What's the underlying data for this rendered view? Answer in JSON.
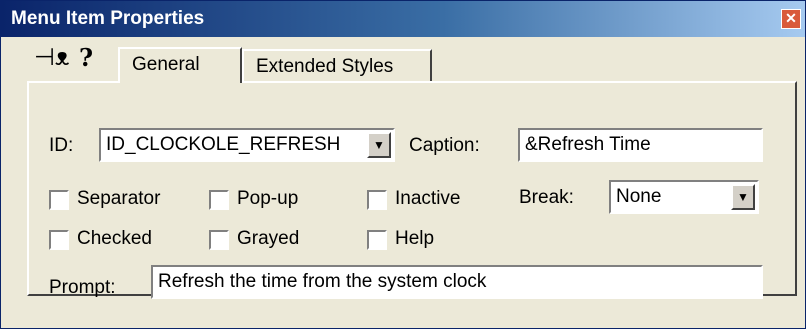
{
  "window": {
    "title": "Menu Item Properties",
    "close_glyph": "✕"
  },
  "toolbar": {
    "pin_icon": "push-pin-icon",
    "help_icon": "help-icon"
  },
  "tabs": [
    {
      "label": "General",
      "active": true
    },
    {
      "label": "Extended Styles",
      "active": false
    }
  ],
  "form": {
    "id_label": "ID:",
    "id_value": "ID_CLOCKOLE_REFRESH",
    "caption_label": "Caption:",
    "caption_value": "&Refresh Time",
    "break_label": "Break:",
    "break_value": "None",
    "prompt_label": "Prompt:",
    "prompt_value": "Refresh the time from the system clock",
    "checkboxes": [
      {
        "label": "Separator",
        "checked": false
      },
      {
        "label": "Pop-up",
        "checked": false
      },
      {
        "label": "Inactive",
        "checked": false
      },
      {
        "label": "Checked",
        "checked": false
      },
      {
        "label": "Grayed",
        "checked": false
      },
      {
        "label": "Help",
        "checked": false
      }
    ]
  }
}
